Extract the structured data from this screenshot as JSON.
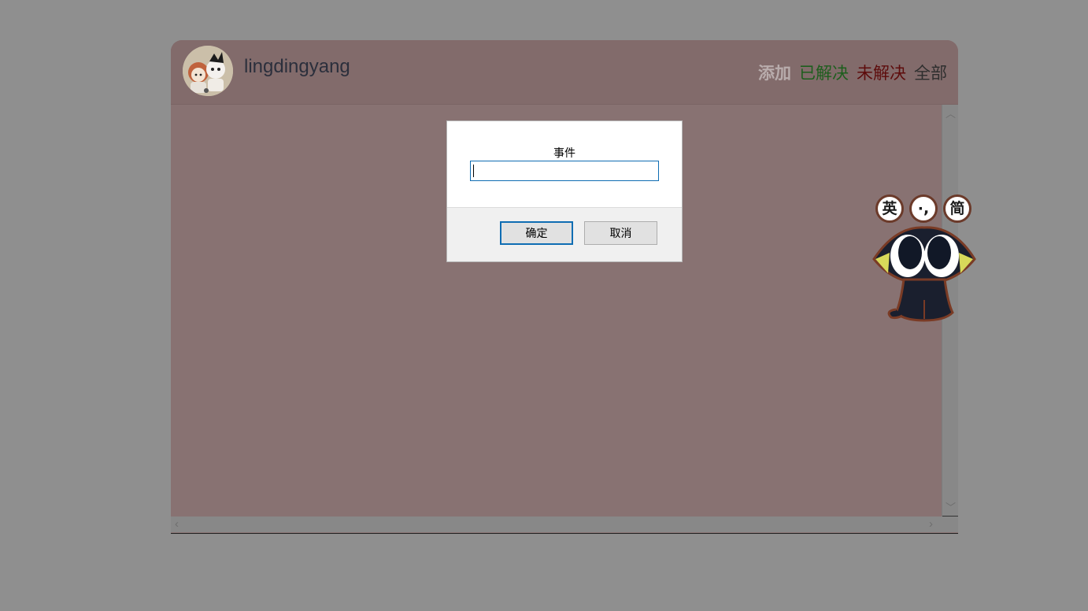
{
  "header": {
    "username": "lingdingyang",
    "nav": {
      "add": "添加",
      "solved": "已解决",
      "unsolved": "未解决",
      "all": "全部"
    }
  },
  "dialog": {
    "label": "事件",
    "input_value": "",
    "ok_label": "确定",
    "cancel_label": "取消"
  },
  "ime": {
    "english_key": "英",
    "punctuation_key": "·,",
    "simplified_key": "简"
  },
  "colors": {
    "nav_add": "#b8acac",
    "nav_solved": "#1d5e1d",
    "nav_unsolved": "#5d0c0c",
    "nav_all": "#2e2e2e",
    "focus_border": "#0f6db3"
  }
}
